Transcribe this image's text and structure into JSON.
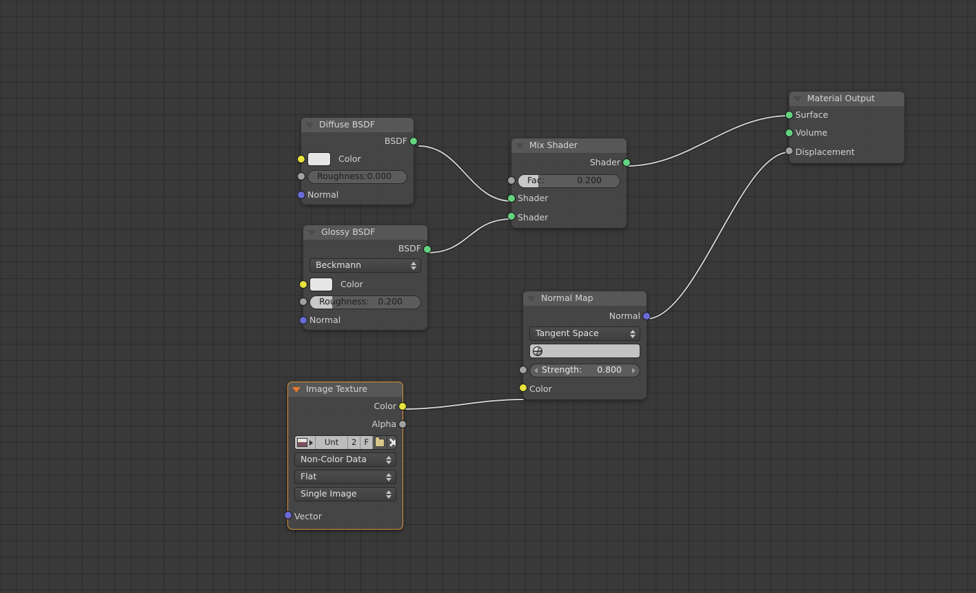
{
  "editor": {
    "name": "blender-shader-node-editor",
    "background_color": "#393939",
    "grid_color": "#303030",
    "link_color": "#d0d0d0"
  },
  "socket_colors": {
    "shader": "#64d37f",
    "color": "#e8e33c",
    "value": "#a1a1a1",
    "vector": "#6a6ad4"
  },
  "nodes": {
    "diffuse": {
      "title": "Diffuse BSDF",
      "outputs": [
        {
          "label": "BSDF",
          "type": "shader"
        }
      ],
      "color_label": "Color",
      "color_value": "#e6e6e6",
      "roughness": {
        "label": "Roughness:",
        "value": "0.000",
        "fill_pct": 0
      },
      "normal_label": "Normal"
    },
    "glossy": {
      "title": "Glossy BSDF",
      "outputs": [
        {
          "label": "BSDF",
          "type": "shader"
        }
      ],
      "distribution": "Beckmann",
      "color_label": "Color",
      "color_value": "#e6e6e6",
      "roughness": {
        "label": "Roughness:",
        "value": "0.200",
        "fill_pct": 20
      },
      "normal_label": "Normal"
    },
    "mix_shader": {
      "title": "Mix Shader",
      "outputs": [
        {
          "label": "Shader",
          "type": "shader"
        }
      ],
      "fac": {
        "label": "Fac:",
        "value": "0.200",
        "fill_pct": 20
      },
      "inputs": [
        {
          "label": "Shader",
          "type": "shader"
        },
        {
          "label": "Shader",
          "type": "shader"
        }
      ]
    },
    "material_output": {
      "title": "Material Output",
      "inputs": [
        {
          "label": "Surface",
          "type": "shader"
        },
        {
          "label": "Volume",
          "type": "shader"
        },
        {
          "label": "Displacement",
          "type": "value"
        }
      ]
    },
    "normal_map": {
      "title": "Normal Map",
      "outputs": [
        {
          "label": "Normal",
          "type": "vector"
        }
      ],
      "space": "Tangent Space",
      "uv_map": "",
      "uv_icon": "globe-icon",
      "strength": {
        "label": "Strength:",
        "value": "0.800",
        "fill_pct": 80
      },
      "color_label": "Color"
    },
    "image_texture": {
      "title": "Image Texture",
      "selected": true,
      "outputs": [
        {
          "label": "Color",
          "type": "color"
        },
        {
          "label": "Alpha",
          "type": "value"
        }
      ],
      "datablock": {
        "image_icon": "image-icon",
        "name": "Unt",
        "users": "2",
        "fake_user": "F",
        "new_icon": "new-image-icon",
        "delete_icon": "close-icon"
      },
      "color_space": "Non-Color Data",
      "extension": "Flat",
      "source": "Single Image",
      "vector_label": "Vector"
    }
  }
}
